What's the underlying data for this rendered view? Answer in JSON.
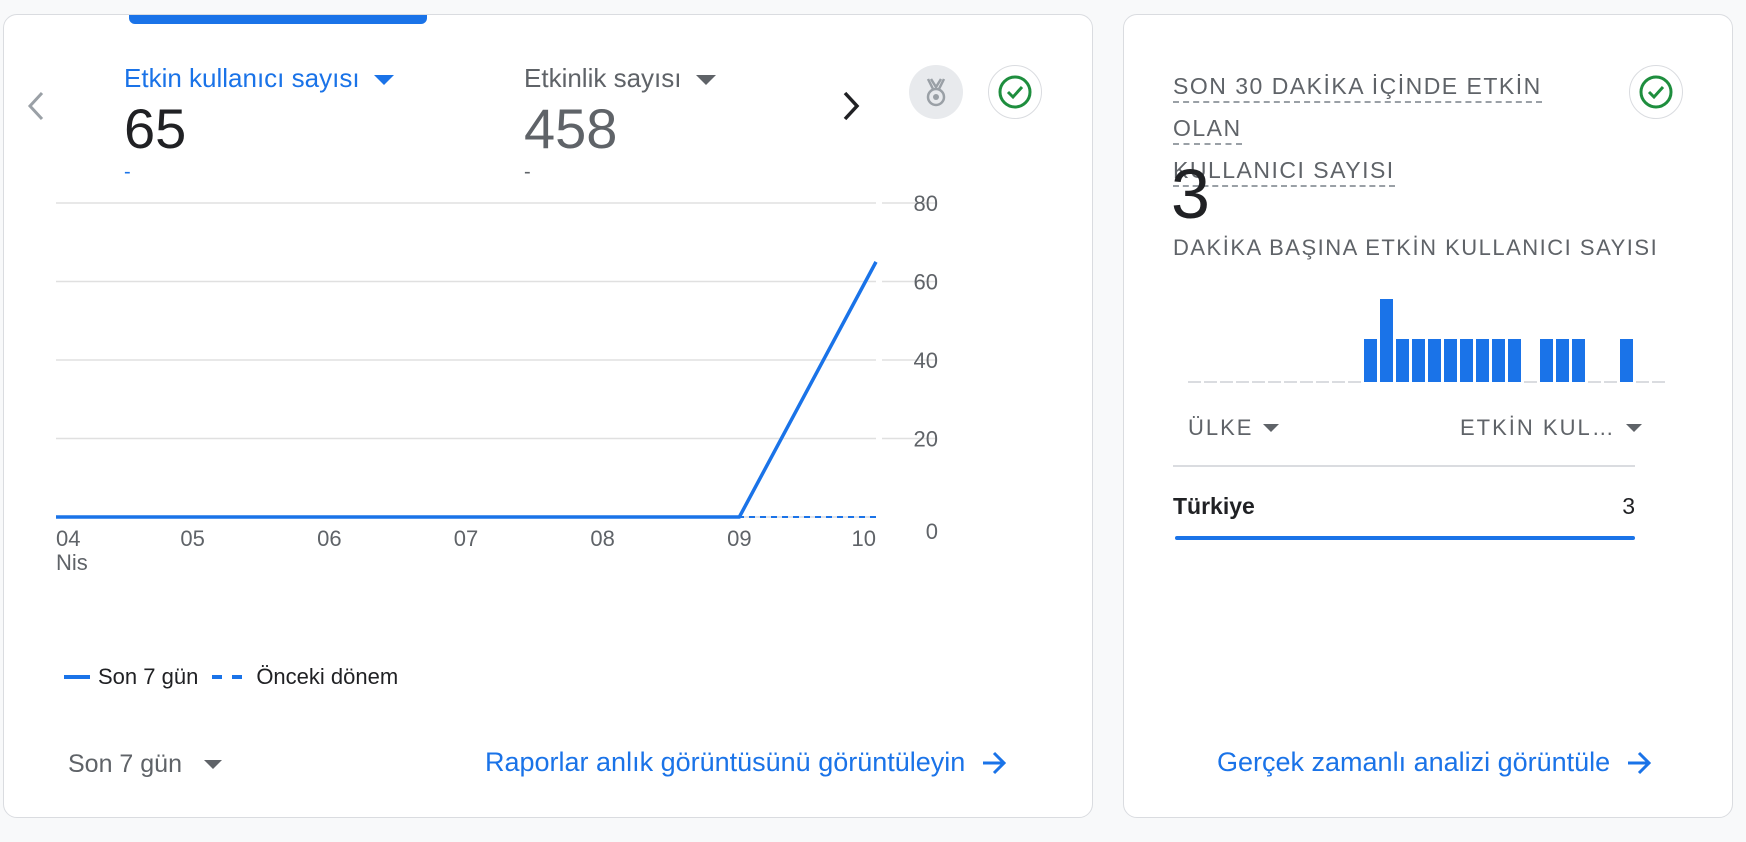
{
  "overview_card": {
    "metrics": [
      {
        "label": "Etkin kullanıcı sayısı",
        "value": "65",
        "delta": "-",
        "active": true
      },
      {
        "label": "Etkinlik sayısı",
        "value": "458",
        "delta": "-",
        "active": false
      }
    ],
    "legend": {
      "current": "Son 7 gün",
      "previous": "Önceki dönem"
    },
    "date_range": "Son 7 gün",
    "link": "Raporlar anlık görüntüsünü görüntüleyin"
  },
  "chart_data": {
    "type": "line",
    "categories": [
      "04",
      "05",
      "06",
      "07",
      "08",
      "09",
      "10"
    ],
    "x_sublabel": "Nis",
    "yticks": [
      0,
      20,
      40,
      60,
      80
    ],
    "ylim": [
      0,
      80
    ],
    "grid": true,
    "legend_position": "bottom-left",
    "series": [
      {
        "name": "Son 7 gün",
        "style": "solid",
        "color": "#1a73e8",
        "values": [
          0,
          0,
          0,
          0,
          0,
          0,
          65
        ]
      },
      {
        "name": "Önceki dönem",
        "style": "dashed",
        "color": "#1a73e8",
        "values": [
          0,
          0,
          0,
          0,
          0,
          0,
          0
        ]
      }
    ]
  },
  "realtime_card": {
    "title": "SON 30 DAKİKA İÇİNDE ETKİN OLAN KULLANICI SAYISI",
    "title_line1": "SON 30 DAKİKA İÇİNDE ETKİN OLAN",
    "title_line2": "KULLANICI SAYISI",
    "value": "3",
    "subtitle": "DAKİKA BAŞINA ETKİN KULLANICI SAYISI",
    "per_minute": [
      0,
      0,
      0,
      0,
      0,
      0,
      0,
      0,
      0,
      0,
      0,
      1,
      2,
      1,
      1,
      1,
      1,
      1,
      1,
      1,
      1,
      0,
      1,
      1,
      1,
      0,
      0,
      1,
      0,
      0
    ],
    "col_country": "ÜLKE",
    "col_users": "ETKİN KUL…",
    "rows": [
      {
        "country": "Türkiye",
        "users": "3",
        "share": 1
      }
    ],
    "link": "Gerçek zamanlı analizi görüntüle"
  },
  "colors": {
    "accent": "#1a73e8",
    "check": "#1e8e3e",
    "text": "#202124",
    "muted": "#5f6368"
  },
  "icons": {
    "prev": "chevron-left-icon",
    "next": "chevron-right-icon",
    "badge": "medal-icon",
    "status": "check-circle-icon",
    "link": "arrow-right-icon"
  }
}
